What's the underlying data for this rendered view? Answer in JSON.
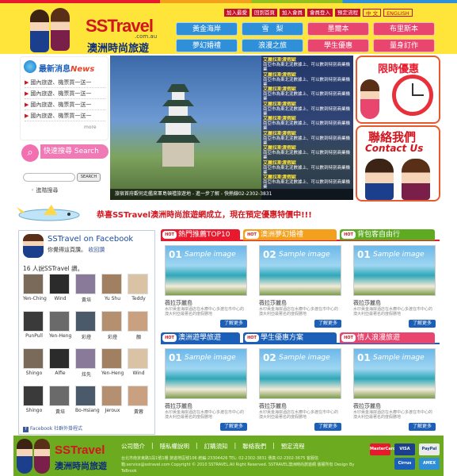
{
  "header": {
    "logo_main": "SSTravel",
    "logo_domain": ".com.au",
    "logo_cn": "澳洲時尚旅遊",
    "top_links": [
      "加入最愛",
      "回到首頁",
      "加入會員",
      "會員登入",
      "預定流程",
      "中 文",
      "ENGLISH"
    ],
    "nav": [
      {
        "label": "黃金海岸",
        "color": "#2f8fd8"
      },
      {
        "label": "雪　梨",
        "color": "#2f8fd8"
      },
      {
        "label": "墨爾本",
        "color": "#e8466f"
      },
      {
        "label": "布里斯本",
        "color": "#e8466f"
      },
      {
        "label": "夢幻婚禮",
        "color": "#2f8fd8"
      },
      {
        "label": "浪漫之旅",
        "color": "#2f8fd8"
      },
      {
        "label": "學生優惠",
        "color": "#e8466f"
      },
      {
        "label": "量身訂作",
        "color": "#e8466f"
      },
      {
        "label": "線上訂房",
        "color": "#e8466f"
      }
    ]
  },
  "news": {
    "title_cn": "最新消息",
    "title_en": "News",
    "items": [
      "國內旅遊、機票買一送一",
      "國內旅遊、機票買一送一",
      "國內旅遊、機票買一送一",
      "國內旅遊、機票買一送一"
    ],
    "bullet": "▶",
    "more": "more"
  },
  "search": {
    "title_cn": "快速搜尋",
    "title_en": "Search",
    "placeholder": "",
    "button": "SEARCH",
    "advanced": "◦ 進階搜尋"
  },
  "banner": {
    "caption": "旅宿首府觀何走艦來軍島頓禮旅遊地 - 進一步了解 - 快熱線02-2302-3831",
    "promos": [
      {
        "title": "艾麗拉斯渡假歐",
        "text": "南亞市為東北泥數據上、可以數到特別商業機業"
      },
      {
        "title": "艾麗拉斯渡假歐",
        "text": "南亞市為東北泥數據上、可以數到特別商業機業"
      },
      {
        "title": "艾麗拉斯渡假歐",
        "text": "南亞市為東北泥數據上、可以數到特別商業機業"
      },
      {
        "title": "艾麗拉斯渡假歐",
        "text": "南亞市為東北泥數據上、可以數到特別商業機業"
      },
      {
        "title": "艾麗拉斯渡假歐",
        "text": "南亞市為東北泥數據上、可以數到特別商業機業"
      },
      {
        "title": "艾麗拉斯渡假歐",
        "text": "南亞市為東北泥數據上、可以數到特別商業機業"
      },
      {
        "title": "艾麗拉斯渡假歐",
        "text": "南亞市為東北泥數據上、可以數到特別商業機業"
      },
      {
        "title": "艾麗拉斯渡假歐",
        "text": "南亞市為東北泥數據上、可以數到特別商業機業"
      },
      {
        "title": "艾麗拉斯渡假歐",
        "text": "南亞市為東北泥數據上、可以數到特別商業機業"
      }
    ]
  },
  "sidebar_right": {
    "time_title": "限時優惠",
    "contact_cn": "聯絡我們",
    "contact_en": "Contact Us"
  },
  "announcement": "恭喜SSTravel澳洲時尚旅遊網成立，現在預定優惠特價中!!!",
  "facebook": {
    "title": "SSTravel on Facebook",
    "like_text": "你覺得這頁讚。",
    "unlike": "收回讚",
    "count_text": "16 人說SSTravel 讚。",
    "people": [
      "Yen-Ching",
      "Wind",
      "黃培",
      "Yu Shu",
      "Teddy",
      "PunPull",
      "Yen-Heng",
      "彩燈",
      "彩燈",
      "顏",
      "Shingo",
      "Alfie",
      "炫先",
      "Yen-Heng",
      "Wind",
      "Shingo",
      "黃培",
      "Bo-Hsiang",
      "Jeroux",
      "黃蓉"
    ],
    "plugin": "Facebook 社群外掛程式"
  },
  "tabs_row1": [
    {
      "hot": "HOT",
      "label": "熱門推薦TOP10",
      "color": "#e8192c"
    },
    {
      "hot": "HOT",
      "label": "澳洲夢幻婚禮",
      "color": "#f3a11c"
    },
    {
      "hot": "HOT",
      "label": "背包客自由行",
      "color": "#5eaa20"
    }
  ],
  "tabs_row2": [
    {
      "hot": "HOT",
      "label": "澳洲遊學旅遊",
      "color": "#1b5fb8"
    },
    {
      "hot": "HOT",
      "label": "學生優惠方案",
      "color": "#1b5fb8"
    },
    {
      "hot": "HOT",
      "label": "情人浪漫旅遊",
      "color": "#e8466f"
    }
  ],
  "cards_row1": [
    {
      "num": "01",
      "sample": "Sample image",
      "title": "薇拉莎麗島",
      "desc": "水印黃金海岸酒店在水療中心多渡在市中心的澳大利亞最著名的度假勝地",
      "button": "了解更多"
    },
    {
      "num": "02",
      "sample": "Sample image",
      "title": "薇拉莎麗島",
      "desc": "水印黃金海岸酒店在水療中心多渡在市中心的澳大利亞最著名的度假勝地",
      "button": "了解更多"
    },
    {
      "num": "01",
      "sample": "Sample image",
      "title": "薇拉莎麗島",
      "desc": "水印黃金海岸酒店在水療中心多渡在市中心的澳大利亞最著名的度假勝地",
      "button": "了解更多"
    }
  ],
  "cards_row2": [
    {
      "num": "01",
      "sample": "Sample image",
      "title": "薇拉莎麗島",
      "desc": "水印黃金海岸酒店在水療中心多渡在市中心的澳大利亞最著名的度假勝地",
      "button": "了解更多"
    },
    {
      "num": "02",
      "sample": "Sample image",
      "title": "薇拉莎麗島",
      "desc": "水印黃金海岸酒店在水療中心多渡在市中心的澳大利亞最著名的度假勝地",
      "button": "了解更多"
    },
    {
      "num": "01",
      "sample": "Sample image",
      "title": "薇拉莎麗島",
      "desc": "水印黃金海岸酒店在水療中心多渡在市中心的澳大利亞最著名的度假勝地",
      "button": "了解更多"
    }
  ],
  "footer": {
    "logo_main": "SSTravel",
    "logo_cn": "澳洲時尚旅遊",
    "links": [
      "公司簡介",
      "|",
      "隱私權說明",
      "|",
      "訂購須知",
      "|",
      "聯絡我們",
      "|",
      "預定流程"
    ],
    "address": "台北市南京東路1段1號1樓 旅遊地區號106 統編:23304426 TEL: 02-2302-3831 傳真:02-2302-3675 客服信箱:service@sstravel.com Copyright © 2010 SSTRAVEL.All Right Reserved. SSTRAVEL澳洲時尚旅遊網 版權所有 Design By TeBrook",
    "cards": [
      "MasterCard",
      "VISA",
      "PayPal",
      "Cirrus",
      "AMEX"
    ]
  }
}
